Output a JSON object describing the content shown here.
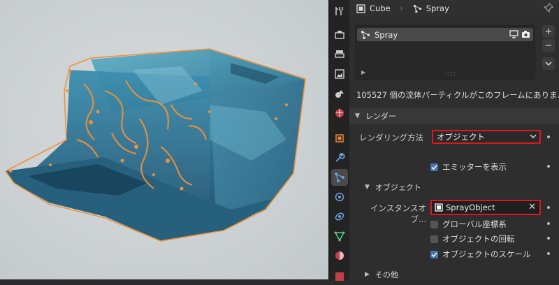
{
  "breadcrumb": {
    "object": "Cube",
    "particle": "Spray"
  },
  "particle_list": {
    "items": [
      {
        "label": "Spray"
      }
    ],
    "add_label": "+",
    "remove_label": "−"
  },
  "info_text": "105527 個の流体パーティクルがこのフレームにありま...",
  "render_panel": {
    "title": "レンダー",
    "render_as_label": "レンダリング方法",
    "render_as_value": "オブジェクト",
    "show_emitter_label": "エミッターを表示",
    "show_emitter": true
  },
  "object_panel": {
    "title": "オブジェクト",
    "instance_label": "インスタンスオブ...",
    "instance_value": "SprayObject",
    "global_coords_label": "グローバル座標系",
    "global_coords": false,
    "object_rotation_label": "オブジェクトの回転",
    "object_rotation": false,
    "object_scale_label": "オブジェクトのスケール",
    "object_scale": true
  },
  "other_panel": {
    "title": "その他"
  },
  "colors": {
    "highlight_border": "#e0161d",
    "checkbox_on": "#4772b3",
    "selection_outline": "#f0913a",
    "mesh_blue": "#2f7ea0"
  },
  "tool_icons": [
    "tool-settings-icon",
    "render-icon",
    "output-icon",
    "view-layer-icon",
    "scene-icon",
    "world-icon",
    "object-icon",
    "modifier-icon",
    "particles-icon",
    "physics-icon",
    "constraints-icon",
    "data-icon",
    "material-icon",
    "texture-icon"
  ]
}
